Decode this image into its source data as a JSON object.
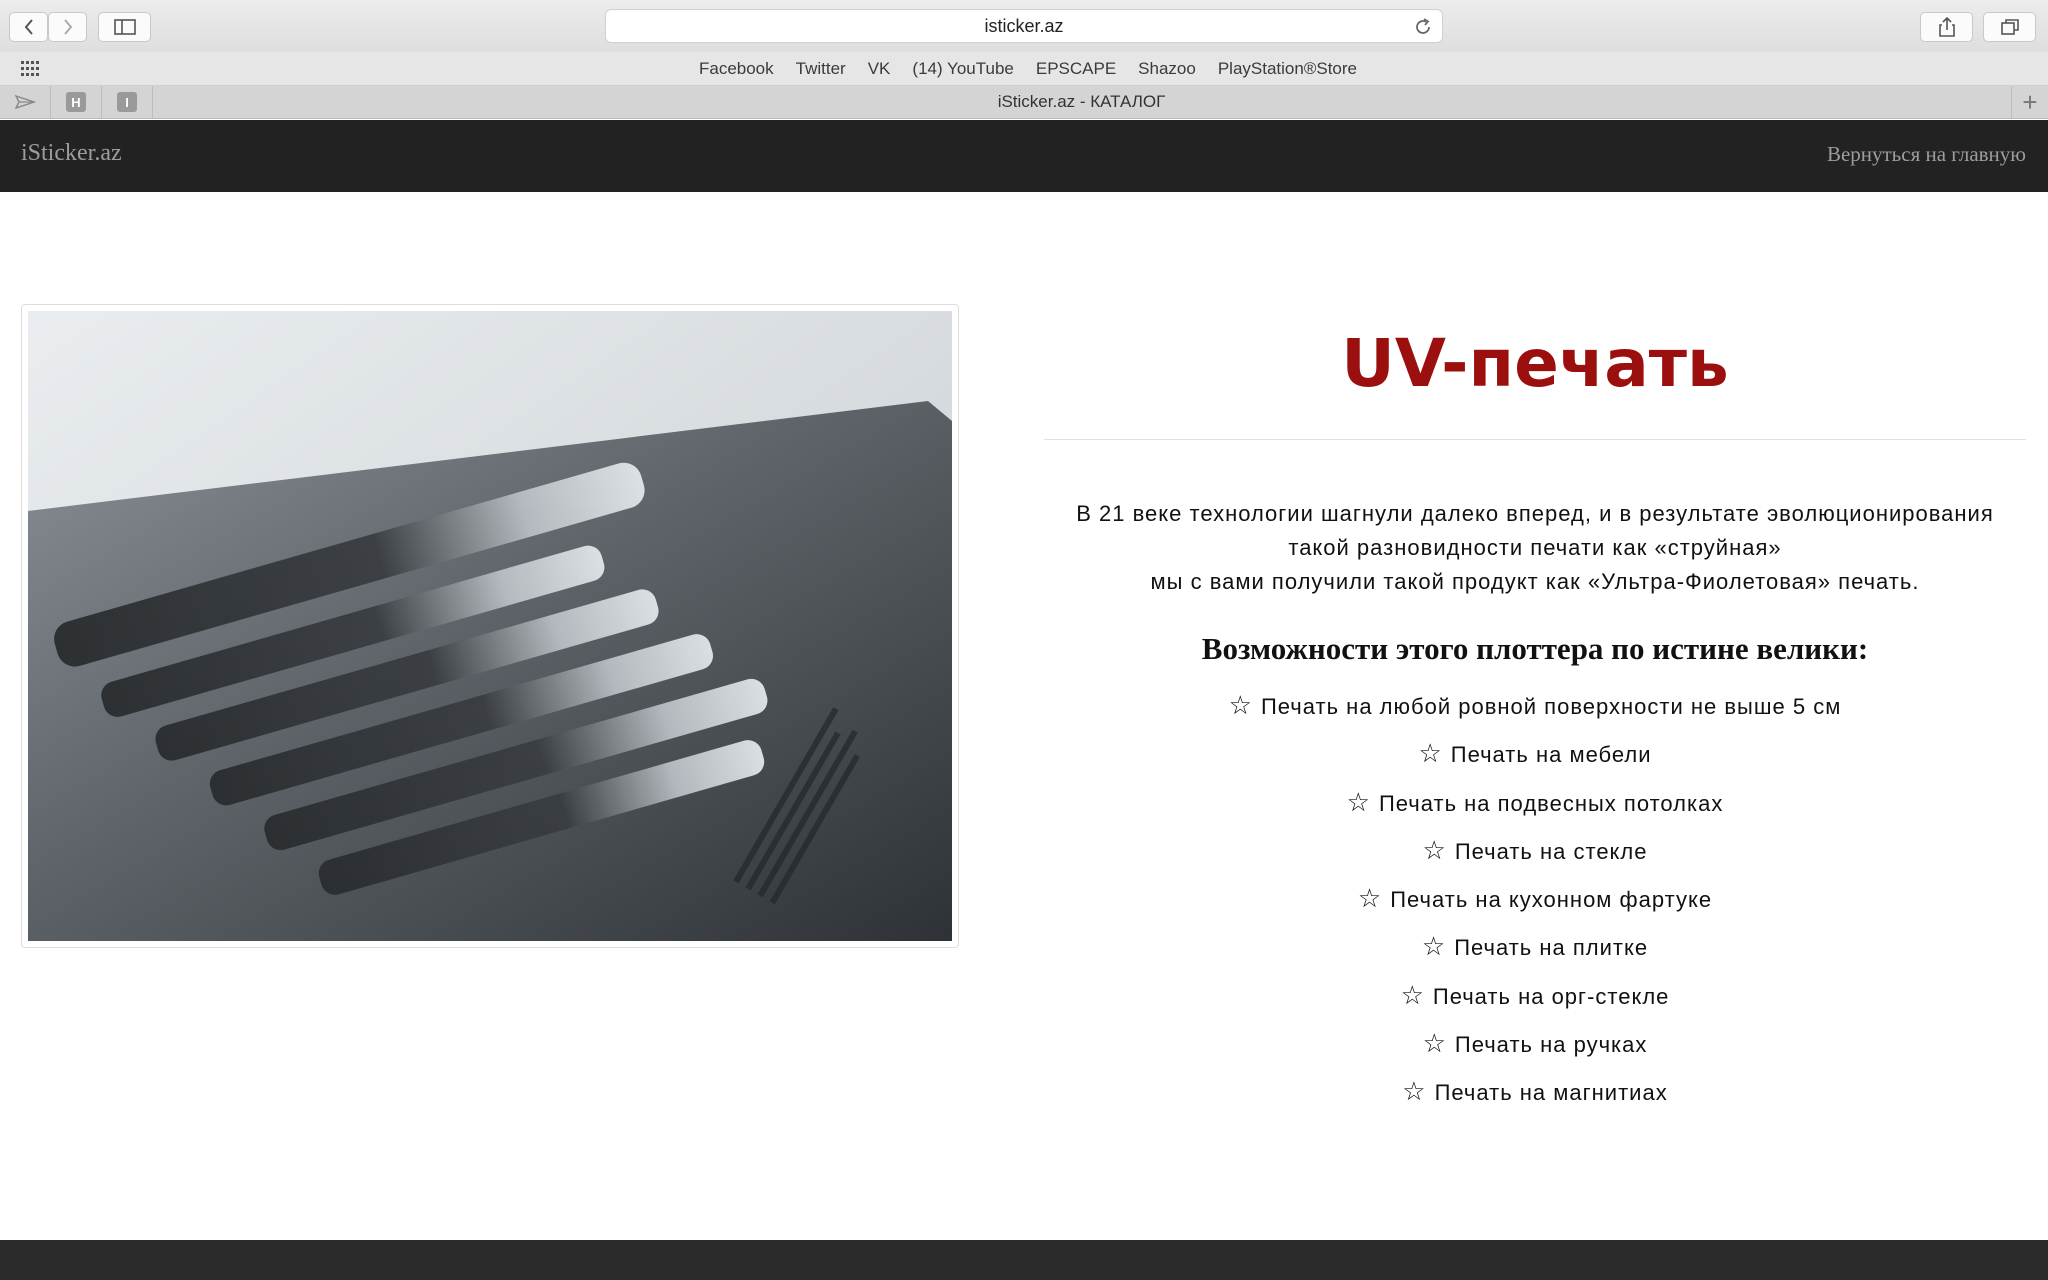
{
  "browser": {
    "url": "isticker.az",
    "tab_title": "iSticker.az - КАТАЛОГ",
    "pinned_tabs": [
      "H",
      "I"
    ],
    "bookmarks": [
      "Facebook",
      "Twitter",
      "VK",
      "(14) YouTube",
      "EPSCAPE",
      "Shazoo",
      "PlayStation®Store"
    ]
  },
  "site": {
    "brand": "iSticker.az",
    "back_link": "Вернуться на главную"
  },
  "content": {
    "title": "UV-печать",
    "intro_lines": [
      "В 21 веке технологии шагнули далеко вперед, и в результате эволюционирования",
      "такой разновидности печати как «струйная»",
      "мы с вами получили такой продукт как «Ультра-Фиолетовая» печать."
    ],
    "subheading": "Возможности этого плоттера по истине велики:",
    "star_symbol": "☆",
    "features": [
      "Печать на любой ровной поверхности не выше 5 см",
      "Печать на мебели",
      "Печать на подвесных потолках",
      "Печать на стекле",
      "Печать на кухонном фартуке",
      "Печать на плитке",
      "Печать на орг-стекле",
      "Печать на ручках",
      "Печать на магнитиах"
    ]
  },
  "colors": {
    "title_red": "#9b0f0f",
    "navbar_bg": "#222222",
    "footer_bg": "#2b2b2b"
  }
}
